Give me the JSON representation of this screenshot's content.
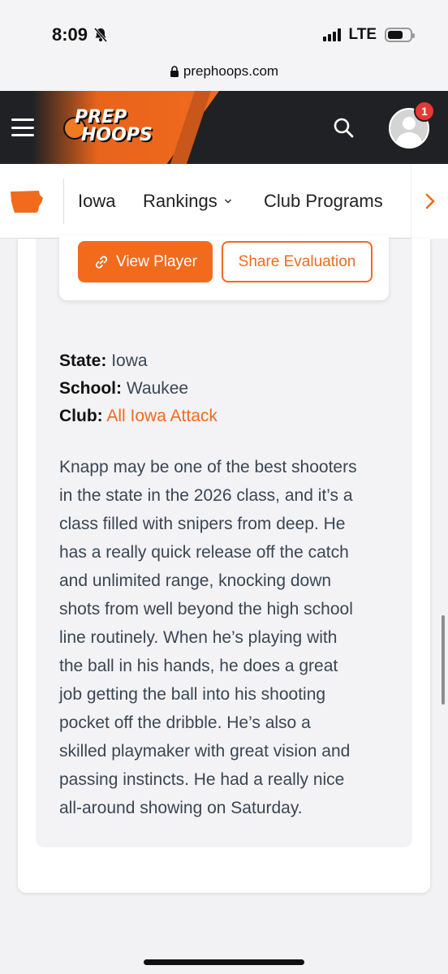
{
  "status_bar": {
    "time": "8:09",
    "network": "LTE"
  },
  "browser": {
    "url": "prephoops.com"
  },
  "header": {
    "logo_line1": "PREP",
    "logo_line2": "HOOPS",
    "notification_count": "1",
    "brand_color": "#f26b1d"
  },
  "state_nav": {
    "items": [
      {
        "label": "Iowa"
      },
      {
        "label": "Rankings"
      },
      {
        "label": "Club Programs"
      }
    ]
  },
  "player_card": {
    "view_label": "View Player",
    "share_label": "Share Evaluation"
  },
  "details": {
    "state_label": "State:",
    "state_value": "Iowa",
    "school_label": "School:",
    "school_value": "Waukee",
    "club_label": "Club:",
    "club_value": "All Iowa Attack"
  },
  "evaluation": {
    "lines": [
      "Knapp may be one of the best shooters",
      "in the state in the 2026 class, and it’s a",
      "class filled with snipers from deep. He",
      "has a really quick release off the catch",
      "and unlimited range, knocking down",
      "shots from well beyond the high school",
      "line routinely. When he’s playing with",
      "the ball in his hands, he does a great",
      "job getting the ball into his shooting",
      "pocket off the dribble. He’s also a",
      "skilled playmaker with great vision and",
      "passing instincts. He had a really nice",
      "all-around showing on Saturday."
    ]
  }
}
